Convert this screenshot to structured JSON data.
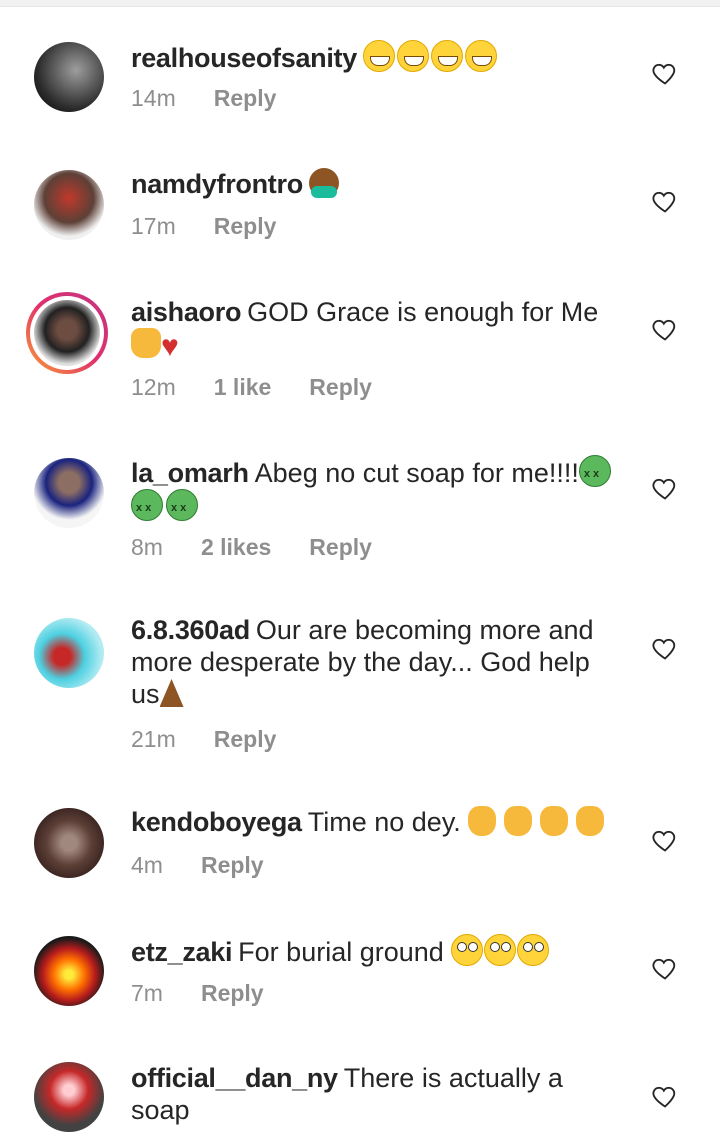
{
  "comments": [
    {
      "user": "realhouseofsanity",
      "text": "",
      "emojis": "grin x4",
      "time": "14m",
      "likes": "",
      "reply": "Reply"
    },
    {
      "user": "namdyfrontro",
      "text": "",
      "emojis": "facepalm",
      "time": "17m",
      "likes": "",
      "reply": "Reply"
    },
    {
      "user": "aishaoro",
      "text": "GOD Grace is enough for Me",
      "emojis": "raised-hands heart",
      "time": "12m",
      "likes": "1 like",
      "reply": "Reply"
    },
    {
      "user": "la_omarh",
      "text": "Abeg no cut soap for me!!!!",
      "emojis": "sick x3",
      "time": "8m",
      "likes": "2 likes",
      "reply": "Reply"
    },
    {
      "user": "6.8.360ad",
      "text": "Our are becoming more and more desperate by the day... God help us",
      "emojis": "pray",
      "time": "21m",
      "likes": "",
      "reply": "Reply"
    },
    {
      "user": "kendoboyega",
      "text": "Time no dey.",
      "emojis": "clap x4",
      "time": "4m",
      "likes": "",
      "reply": "Reply"
    },
    {
      "user": "etz_zaki",
      "text": "For burial ground",
      "emojis": "eye-roll x3",
      "time": "7m",
      "likes": "",
      "reply": "Reply"
    },
    {
      "user": "official__dan_ny",
      "text": "There is actually a soap",
      "emojis": "",
      "time": "",
      "likes": "",
      "reply": ""
    }
  ],
  "icons": {
    "like": "heart-outline-icon"
  },
  "colors": {
    "meta": "#8e8e8e",
    "text": "#262626",
    "story_ring_start": "#f9a233",
    "story_ring_end": "#c13584"
  }
}
